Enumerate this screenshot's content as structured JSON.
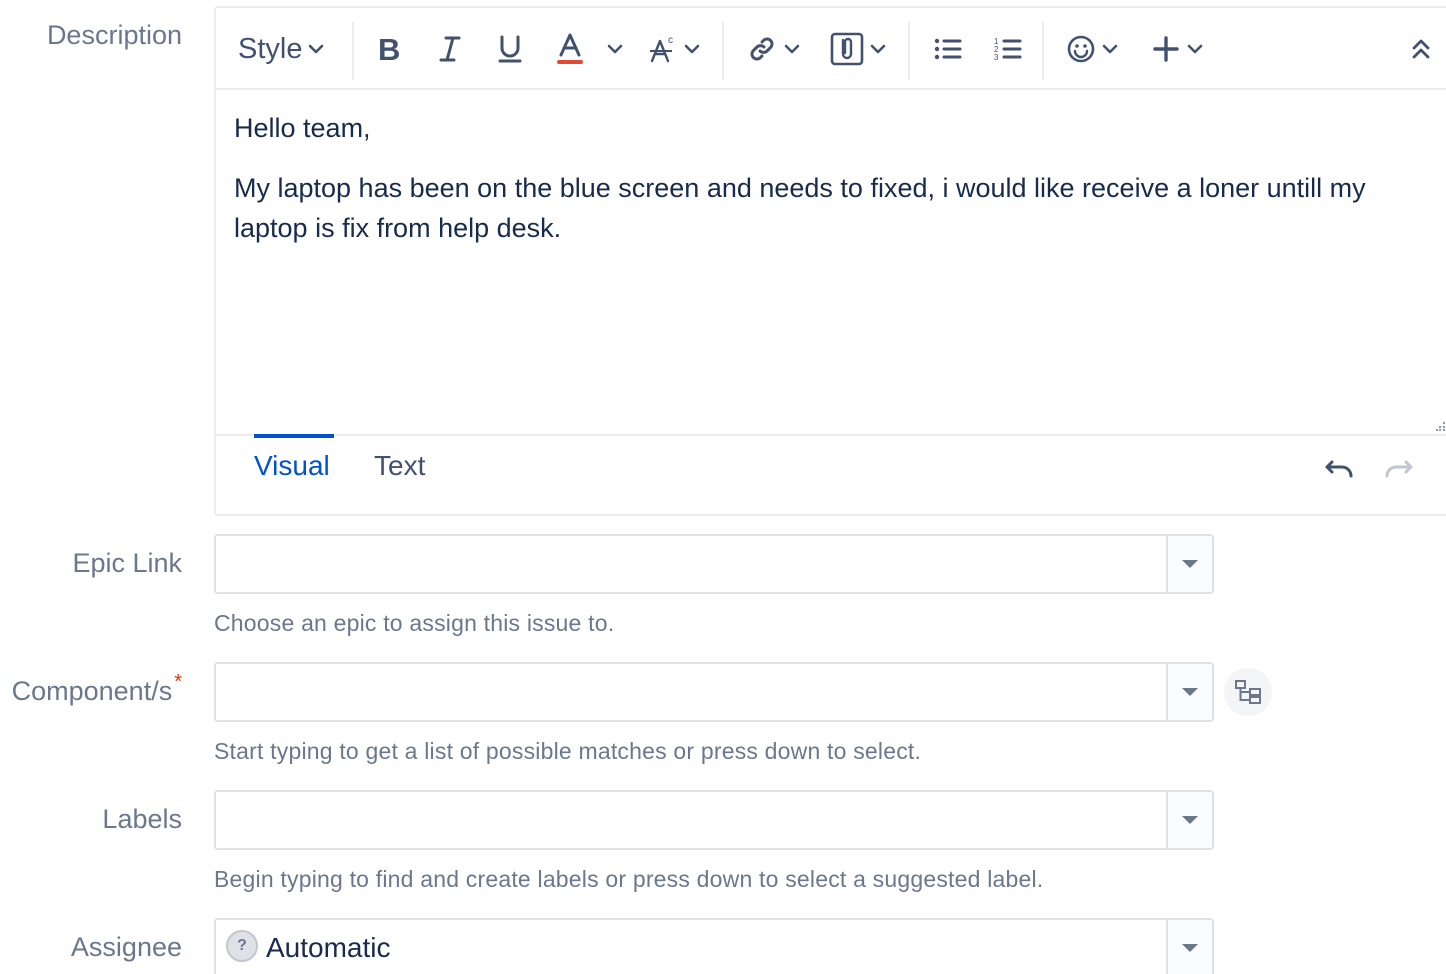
{
  "fields": {
    "description": {
      "label": "Description"
    },
    "epic_link": {
      "label": "Epic Link",
      "value": "",
      "help": "Choose an epic to assign this issue to."
    },
    "components": {
      "label": "Component/s",
      "required_mark": "*",
      "value": "",
      "help": "Start typing to get a list of possible matches or press down to select."
    },
    "labels": {
      "label": "Labels",
      "value": "",
      "help": "Begin typing to find and create labels or press down to select a suggested label."
    },
    "assignee": {
      "label": "Assignee",
      "value": "Automatic",
      "avatar_glyph": "?"
    }
  },
  "editor": {
    "toolbar": {
      "style_label": "Style",
      "icons": [
        "bold-icon",
        "italic-icon",
        "underline-icon",
        "text-color-icon",
        "text-format-icon",
        "link-icon",
        "attachment-icon",
        "bullet-list-icon",
        "numbered-list-icon",
        "emoji-icon",
        "insert-icon",
        "collapse-toolbar-icon"
      ],
      "text_color_underline": "#e34935"
    },
    "content": {
      "paragraphs": [
        "Hello team,",
        "My laptop has been on the blue screen and needs to fixed, i would like receive a loner untill my laptop is fix from help desk."
      ]
    },
    "tabs": [
      {
        "label": "Visual",
        "active": true
      },
      {
        "label": "Text",
        "active": false
      }
    ]
  },
  "colors": {
    "accent": "#0052cc",
    "text": "#172b4d",
    "muted": "#6b778c",
    "border": "#dfe1e6",
    "required": "#de350b"
  }
}
